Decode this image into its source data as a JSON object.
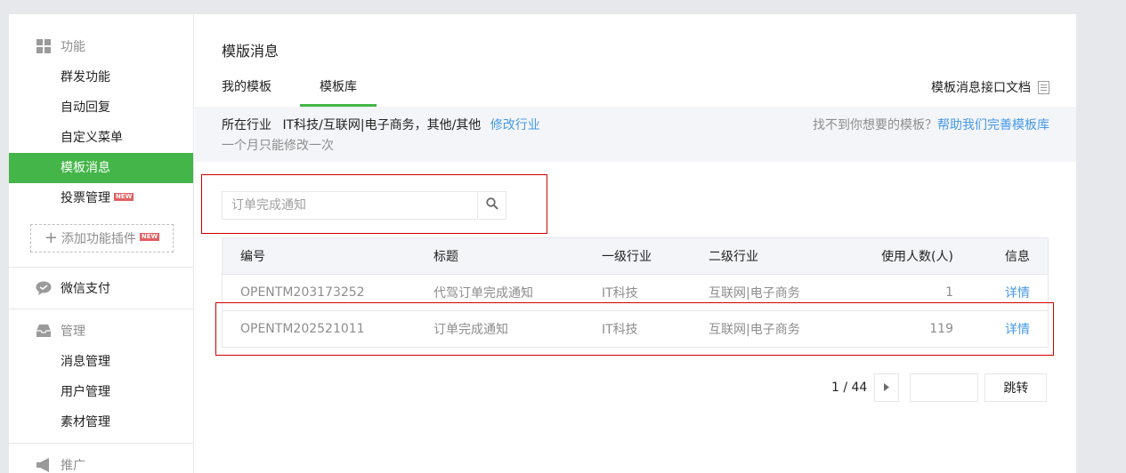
{
  "sidebar": {
    "group_features": {
      "label": "功能",
      "items": [
        {
          "label": "群发功能"
        },
        {
          "label": "自动回复"
        },
        {
          "label": "自定义菜单"
        },
        {
          "label": "模板消息"
        },
        {
          "label": "投票管理",
          "badge": "NEW"
        }
      ],
      "add_plugin": {
        "label": "添加功能插件",
        "badge": "NEW"
      }
    },
    "group_pay": {
      "label": "微信支付"
    },
    "group_manage": {
      "label": "管理",
      "items": [
        {
          "label": "消息管理"
        },
        {
          "label": "用户管理"
        },
        {
          "label": "素材管理"
        }
      ]
    },
    "group_promo": {
      "label": "推广"
    }
  },
  "main": {
    "title": "模版消息",
    "tabs": [
      {
        "label": "我的模板"
      },
      {
        "label": "模板库"
      }
    ],
    "doc_link": "模板消息接口文档",
    "info": {
      "industry_label": "所在行业",
      "industry_value": "IT科技/互联网|电子商务，其他/其他",
      "modify_link": "修改行业",
      "note": "一个月只能修改一次",
      "help_text": "找不到你想要的模板？",
      "help_link": "帮助我们完善模板库"
    },
    "search": {
      "placeholder": "订单完成通知",
      "value": ""
    },
    "table": {
      "headers": [
        "编号",
        "标题",
        "一级行业",
        "二级行业",
        "使用人数(人)",
        "信息"
      ],
      "rows": [
        {
          "id": "OPENTM203173252",
          "title": "代驾订单完成通知",
          "industry1": "IT科技",
          "industry2": "互联网|电子商务",
          "users": "1",
          "action": "详情"
        },
        {
          "id": "OPENTM202521011",
          "title": "订单完成通知",
          "industry1": "IT科技",
          "industry2": "互联网|电子商务",
          "users": "119",
          "action": "详情"
        }
      ]
    },
    "pager": {
      "page_text": "1 / 44",
      "go_label": "跳转"
    }
  },
  "colors": {
    "accent": "#44b549",
    "link": "#459ae9",
    "highlight_border": "#d20000"
  },
  "icons": [
    "grid-icon",
    "wechat-pay-icon",
    "inbox-icon",
    "megaphone-icon",
    "search-icon",
    "document-icon",
    "next-page-icon",
    "plus-icon"
  ]
}
